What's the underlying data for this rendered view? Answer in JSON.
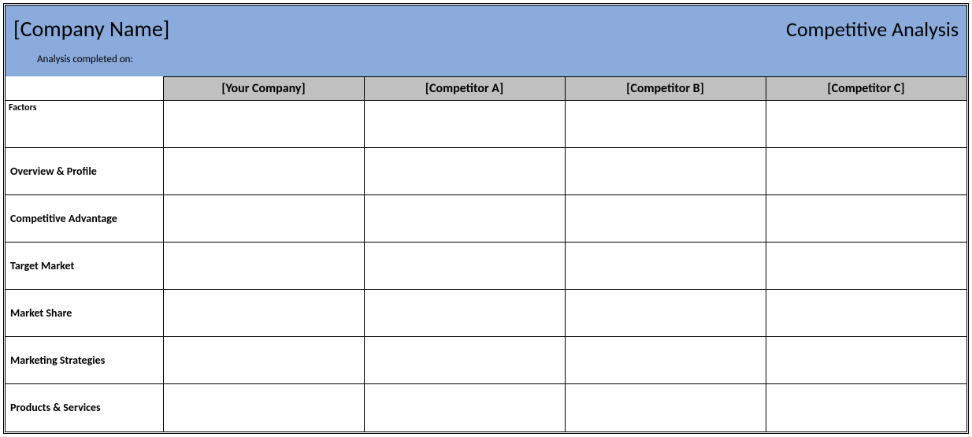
{
  "header": {
    "company_name": "[Company Name]",
    "analysis_date_label": "Analysis completed on:",
    "report_title": "Competitive Analysis"
  },
  "columns": {
    "factors_blank": "",
    "your_company": "[Your Company]",
    "competitor_a": "[Competitor A]",
    "competitor_b": "[Competitor B]",
    "competitor_c": "[Competitor C]"
  },
  "section_label": "Factors",
  "rows": [
    {
      "label": "Overview & Profile",
      "your_company": "",
      "competitor_a": "",
      "competitor_b": "",
      "competitor_c": ""
    },
    {
      "label": "Competitive Advantage",
      "your_company": "",
      "competitor_a": "",
      "competitor_b": "",
      "competitor_c": ""
    },
    {
      "label": "Target Market",
      "your_company": "",
      "competitor_a": "",
      "competitor_b": "",
      "competitor_c": ""
    },
    {
      "label": "Market Share",
      "your_company": "",
      "competitor_a": "",
      "competitor_b": "",
      "competitor_c": ""
    },
    {
      "label": "Marketing Strategies",
      "your_company": "",
      "competitor_a": "",
      "competitor_b": "",
      "competitor_c": ""
    },
    {
      "label": "Products & Services",
      "your_company": "",
      "competitor_a": "",
      "competitor_b": "",
      "competitor_c": ""
    }
  ]
}
